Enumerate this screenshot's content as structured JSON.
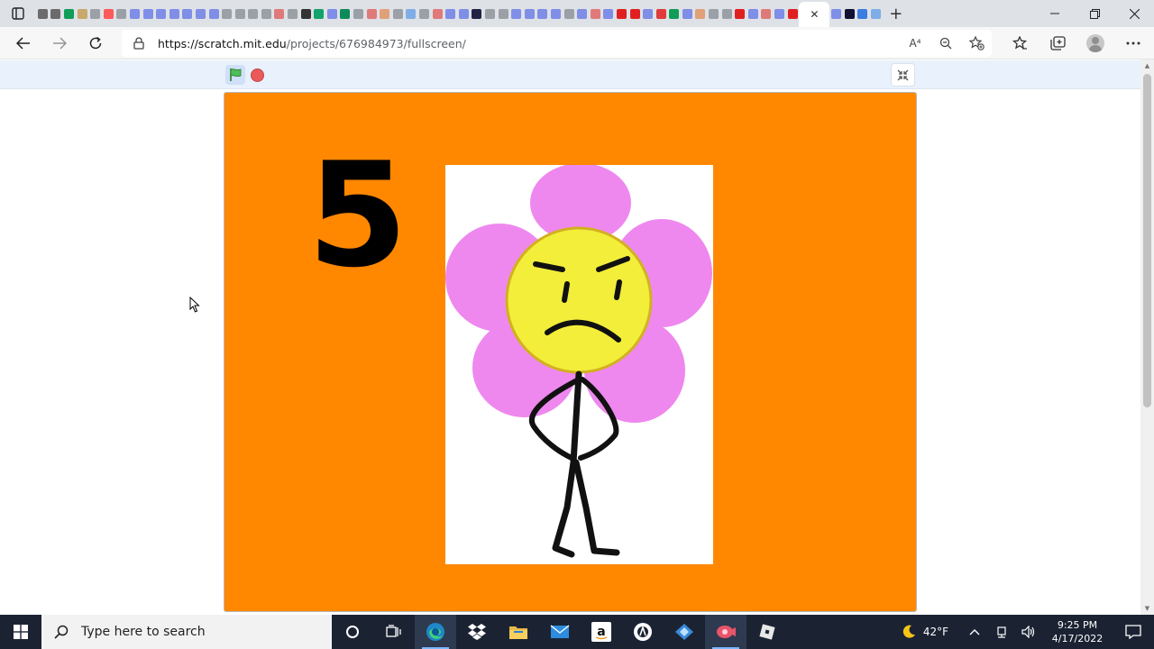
{
  "browser": {
    "tab_favicon_colors": [
      "#6b6b6b",
      "#6b6b6b",
      "#0f9d58",
      "#c9a86b",
      "#9aa0a6",
      "#ff5a5a",
      "#9aa0a6",
      "#7f8ee6",
      "#7f8ee6",
      "#7f8ee6",
      "#7f8ee6",
      "#7f8ee6",
      "#7f8ee6",
      "#7f8ee6",
      "#9aa0a6",
      "#9aa0a6",
      "#9aa0a6",
      "#9aa0a6",
      "#e07a7a",
      "#9aa0a6",
      "#333333",
      "#11a36b",
      "#7f8ee6",
      "#0c8a5b",
      "#9aa0a6",
      "#e07a7a",
      "#e0a07a",
      "#9aa0a6",
      "#7faee6",
      "#9aa0a6",
      "#e07a7a",
      "#7f8ee6",
      "#7f8ee6",
      "#222244",
      "#9aa0a6",
      "#9aa0a6",
      "#7f8ee6",
      "#7f8ee6",
      "#7f8ee6",
      "#7f8ee6",
      "#9aa0a6",
      "#7f8ee6",
      "#e07a7a",
      "#7f8ee6",
      "#e02020",
      "#e02020",
      "#7f8ee6",
      "#e03a3a",
      "#0f9d58",
      "#7f8ee6",
      "#e0a07a",
      "#9aa0a6",
      "#9aa0a6",
      "#e02020",
      "#7f8ee6",
      "#e07a7a",
      "#7f8ee6",
      "#e02020"
    ],
    "active_tab_favicon_colors": [
      "#7f8ee6",
      "#111133",
      "#3b7de0",
      "#7faee6"
    ],
    "new_tab_label": "+",
    "url_host": "https://scratch.mit.edu",
    "url_path": "/projects/676984973/fullscreen/",
    "read_aloud_label": "A⁴"
  },
  "scratch": {
    "stage_color": "#ff8800",
    "big_number": "5",
    "card_color": "#ffffff",
    "petal_color": "#ee88ee",
    "face_color": "#f2ee3a"
  },
  "taskbar": {
    "search_placeholder": "Type here to search",
    "apps": [
      "cortana-icon",
      "task-view-icon",
      "edge-icon",
      "dropbox-icon",
      "file-explorer-icon",
      "mail-icon",
      "amazon-icon",
      "app-circle-icon",
      "app-diamond-icon",
      "recorder-icon",
      "roblox-icon"
    ],
    "weather_temp": "42°F",
    "time": "9:25 PM",
    "date": "4/17/2022"
  }
}
